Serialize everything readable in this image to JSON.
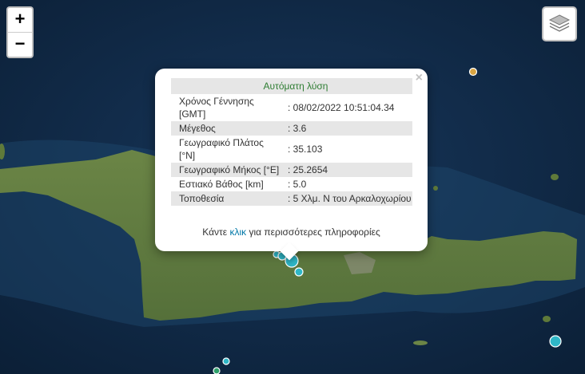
{
  "map": {
    "zoom_in_label": "+",
    "zoom_out_label": "−",
    "layers_icon": "layers-icon",
    "colors": {
      "sea": "#0d2540",
      "land": "#5f7a3a",
      "marker_cyan": "#2fb7c7",
      "marker_orange": "#d9a441"
    },
    "markers": [
      {
        "name": "marker-main",
        "color": "#2fb7c7",
        "size": "large"
      },
      {
        "name": "marker-small",
        "color": "#2fb7c7",
        "size": "small"
      },
      {
        "name": "marker-small",
        "color": "#2fb7c7",
        "size": "small"
      },
      {
        "name": "marker-small",
        "color": "#2fb7c7",
        "size": "small"
      },
      {
        "name": "marker-east",
        "color": "#2fb7c7",
        "size": "medium"
      },
      {
        "name": "marker-north",
        "color": "#d9a441",
        "size": "small"
      },
      {
        "name": "marker-south",
        "color": "#2fb7c7",
        "size": "small"
      },
      {
        "name": "marker-south",
        "color": "#2fb7c7",
        "size": "small"
      }
    ]
  },
  "popup": {
    "close": "×",
    "header": "Αυτόματη λύση",
    "rows": [
      {
        "label": "Χρόνος Γέννησης [GMT]",
        "value": ": 08/02/2022 10:51:04.34"
      },
      {
        "label": "Μέγεθος",
        "value": ": 3.6"
      },
      {
        "label": "Γεωγραφικό Πλάτος [°N]",
        "value": ": 35.103"
      },
      {
        "label": "Γεωγραφικό Μήκος [°E]",
        "value": ": 25.2654"
      },
      {
        "label": "Εστιακό Βάθος [km]",
        "value": ": 5.0"
      },
      {
        "label": "Τοποθεσία",
        "value": ": 5 Χλμ. N του Αρκαλοχωρίου"
      }
    ],
    "more_prefix": "Κάντε",
    "more_link": "κλικ",
    "more_suffix": "για περισσότερες πληροφορίες"
  }
}
